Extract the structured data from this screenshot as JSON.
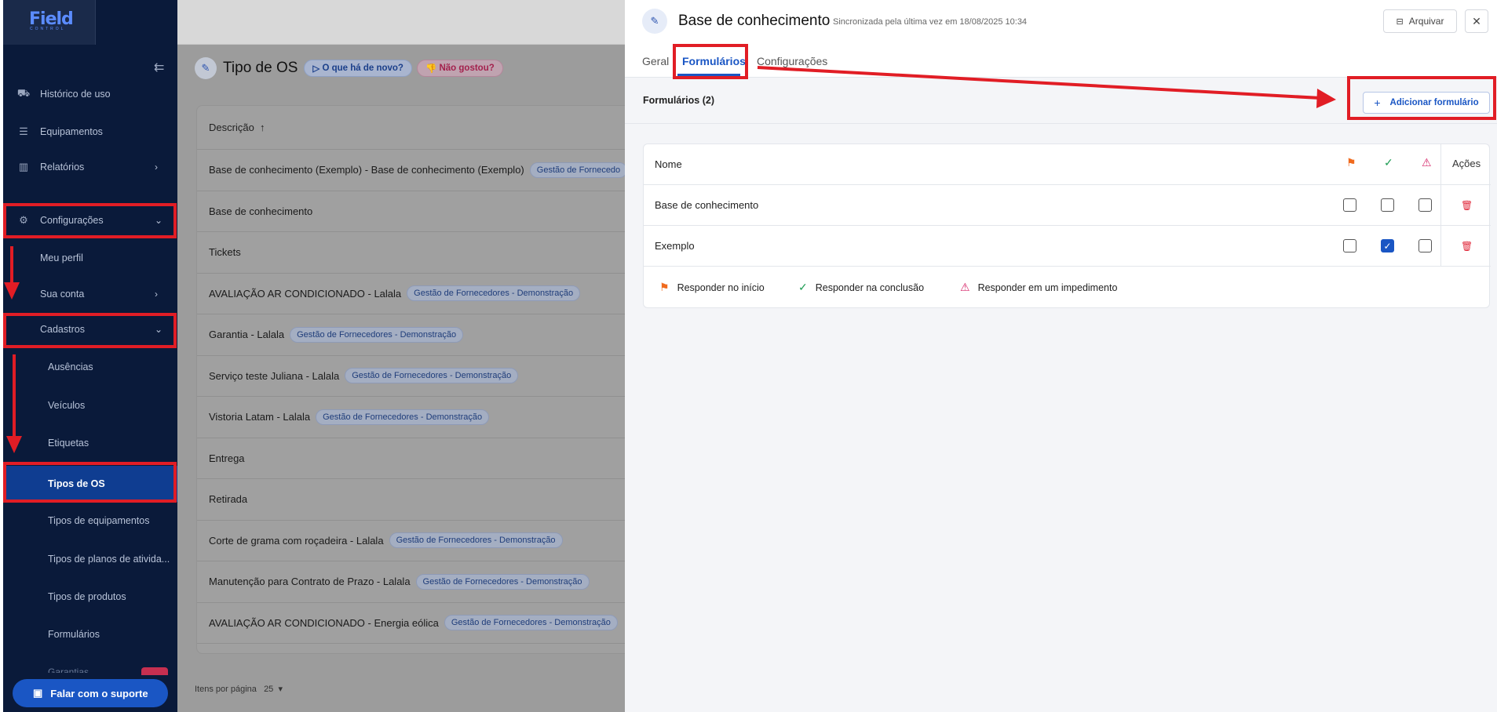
{
  "app": {
    "logo": "Field",
    "logo_sub": "CONTROL"
  },
  "sidebar": {
    "items": [
      {
        "label": "Histórico de uso",
        "icon": "car-icon"
      },
      {
        "label": "Equipamentos",
        "icon": "server-icon"
      },
      {
        "label": "Relatórios",
        "icon": "chart-icon"
      },
      {
        "label": "Configurações",
        "icon": "gear-icon"
      },
      {
        "label": "Meu perfil"
      },
      {
        "label": "Sua conta"
      },
      {
        "label": "Cadastros"
      },
      {
        "label": "Ausências"
      },
      {
        "label": "Veículos"
      },
      {
        "label": "Etiquetas"
      },
      {
        "label": "Tipos de OS"
      },
      {
        "label": "Tipos de equipamentos"
      },
      {
        "label": "Tipos de planos de ativida..."
      },
      {
        "label": "Tipos de produtos"
      },
      {
        "label": "Formulários"
      },
      {
        "label": "Garantias"
      }
    ],
    "support_button": "Falar com o suporte"
  },
  "main": {
    "title": "Tipo de OS",
    "whats_new": "O que há de novo?",
    "disliked": "Não gostou?",
    "column_header": "Descrição",
    "rows": [
      {
        "text": "Base de conhecimento (Exemplo) - Base de conhecimento (Exemplo)",
        "tag": "Gestão de Fornecedo"
      },
      {
        "text": "Base de conhecimento",
        "tag": ""
      },
      {
        "text": "Tickets",
        "tag": ""
      },
      {
        "text": "AVALIAÇÃO AR CONDICIONADO - Lalala",
        "tag": "Gestão de Fornecedores - Demonstração"
      },
      {
        "text": "Garantia - Lalala",
        "tag": "Gestão de Fornecedores - Demonstração"
      },
      {
        "text": "Serviço teste Juliana - Lalala",
        "tag": "Gestão de Fornecedores - Demonstração"
      },
      {
        "text": "Vistoria Latam - Lalala",
        "tag": "Gestão de Fornecedores - Demonstração"
      },
      {
        "text": "Entrega",
        "tag": ""
      },
      {
        "text": "Retirada",
        "tag": ""
      },
      {
        "text": "Corte de grama com roçadeira - Lalala",
        "tag": "Gestão de Fornecedores - Demonstração"
      },
      {
        "text": "Manutenção para Contrato de Prazo - Lalala",
        "tag": "Gestão de Fornecedores - Demonstração"
      },
      {
        "text": "AVALIAÇÃO AR CONDICIONADO - Energia eólica",
        "tag": "Gestão de Fornecedores - Demonstração"
      }
    ],
    "pager_label": "Itens por página",
    "pager_value": "25"
  },
  "panel": {
    "title": "Base de conhecimento",
    "sync_text": "Sincronizada pela última vez em 18/08/2025 10:34",
    "archive_button": "Arquivar",
    "close": "✕",
    "tabs": [
      "Geral",
      "Formulários",
      "Configurações"
    ],
    "active_tab": "Formulários",
    "forms_count": "Formulários (2)",
    "add_form_button": "Adicionar formulário",
    "table": {
      "col_name": "Nome",
      "col_actions": "Ações",
      "rows": [
        {
          "name": "Base de conhecimento",
          "start": false,
          "conclusion": false,
          "impediment": false
        },
        {
          "name": "Exemplo",
          "start": false,
          "conclusion": true,
          "impediment": false
        }
      ]
    },
    "legend": {
      "start": "Responder no início",
      "conclusion": "Responder na conclusão",
      "impediment": "Responder em um impedimento"
    }
  },
  "colors": {
    "primary": "#1a56c4",
    "sidebar_bg": "#0a1a3a",
    "annotation_red": "#e11d25",
    "flag_orange": "#f06a1d",
    "check_green": "#1f9d55",
    "warning_pink": "#d6276a"
  }
}
